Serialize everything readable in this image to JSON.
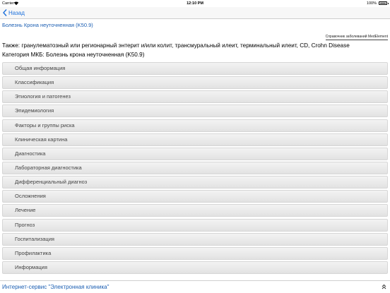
{
  "status_bar": {
    "carrier": "Carrier",
    "time": "12:10 PM",
    "battery": "100%"
  },
  "nav": {
    "back_label": "Назад"
  },
  "page": {
    "title": "Болезнь Крона неуточненная (K50.9)",
    "reference_link": "Справочник заболеваний MedElement",
    "also": "Также: гранулематозный или регионарный энтерит и/или колит, трансмуральный илеит, терминальный илеит, CD, Crohn Disease",
    "category": "Категория МКБ: Болезнь крона неуточненная (K50.9)"
  },
  "sections": [
    "Общая информация",
    "Классификация",
    "Этиология и патогенез",
    "Эпидемиология",
    "Факторы и группы риска",
    "Клиническая картина",
    "Диагностика",
    "Лабораторная диагностика",
    "Дифференциальный диагноз",
    "Осложнения",
    "Лечение",
    "Прогноз",
    "Госпитализация",
    "Профилактика",
    "Информация"
  ],
  "footer": {
    "link": "Интернет-сервис \"Электронная клиника\""
  },
  "colors": {
    "link": "#1c5fb3",
    "nav_tint": "#1a6fdc",
    "section_bg": "#e8e8e8"
  }
}
